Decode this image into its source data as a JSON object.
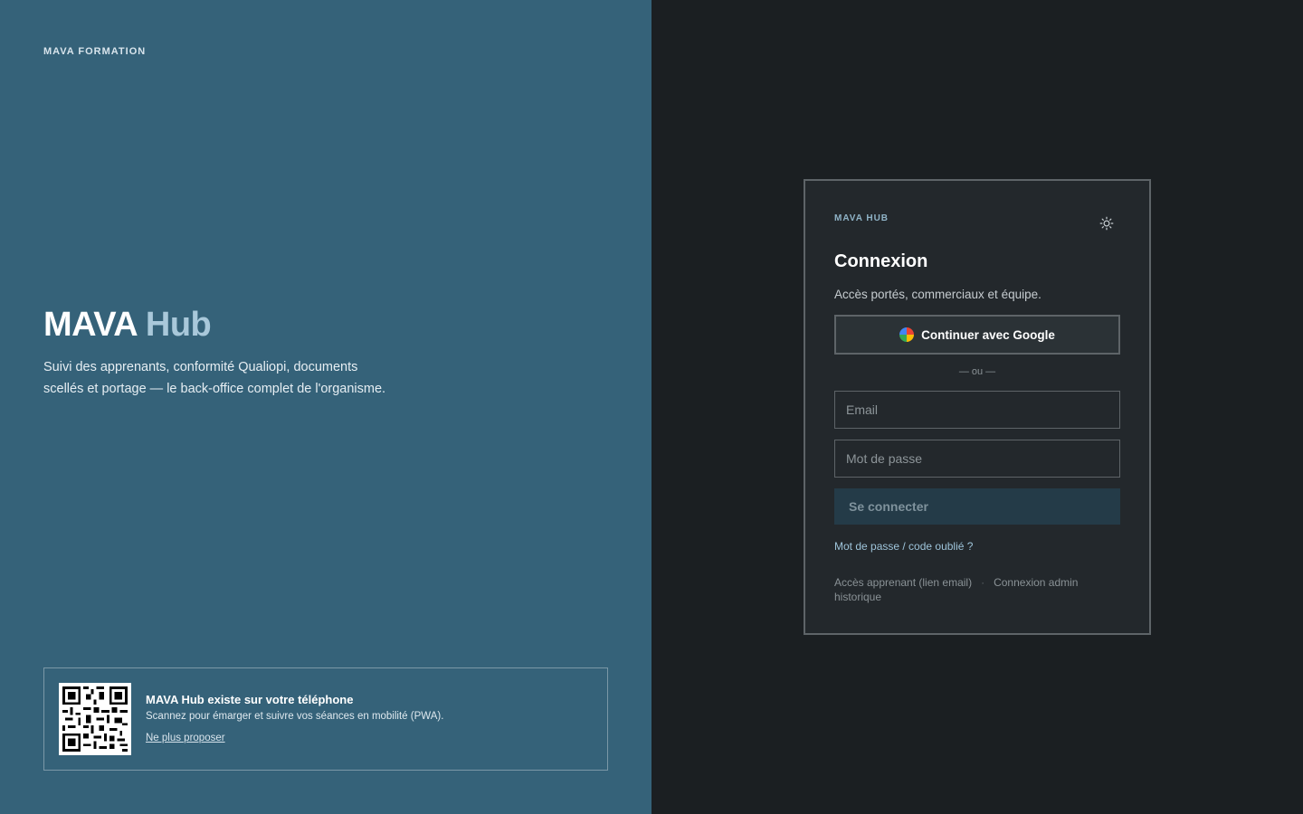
{
  "left": {
    "brand": "MAVA FORMATION",
    "title_main": "MAVA",
    "title_accent": "Hub",
    "description": "Suivi des apprenants, conformité Qualiopi, documents scellés et portage — le back-office complet de l'organisme.",
    "pwa": {
      "title": "MAVA Hub existe sur votre téléphone",
      "subtitle": "Scannez pour émarger et suivre vos séances en mobilité (PWA).",
      "dismiss_link": "Ne plus proposer"
    }
  },
  "login": {
    "brand": "MAVA HUB",
    "theme_icon": "sun-icon",
    "title": "Connexion",
    "subtitle": "Accès portés, commerciaux et équipe.",
    "google_button": "Continuer avec Google",
    "separator": "— ou —",
    "email_placeholder": "Email",
    "password_placeholder": "Mot de passe",
    "submit": "Se connecter",
    "forgot": "Mot de passe / code oublié ?",
    "learner_link": "Accès apprenant (lien email)",
    "dot": "·",
    "admin_link": "Connexion admin historique"
  },
  "colors": {
    "left_bg": "#356279",
    "right_bg": "#1b1f22",
    "card_bg": "#23282c",
    "accent": "#a9c8da"
  }
}
